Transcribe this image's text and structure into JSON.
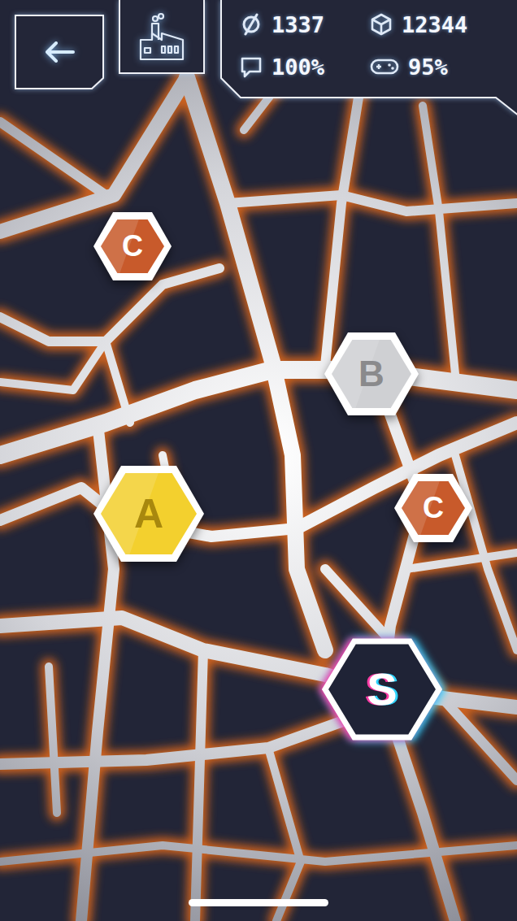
{
  "stats": [
    {
      "kind": "coins",
      "value": "1337"
    },
    {
      "kind": "cubes",
      "value": "12344"
    },
    {
      "kind": "chat",
      "value": "100%"
    },
    {
      "kind": "gamepad",
      "value": "95%"
    }
  ],
  "markers": [
    {
      "label": "C",
      "kind": "small",
      "color": "#c85a2b"
    },
    {
      "label": "B",
      "kind": "medium",
      "color": "#cfd0d3"
    },
    {
      "label": "A",
      "kind": "large",
      "color": "#f3d02e"
    },
    {
      "label": "C",
      "kind": "small",
      "color": "#c85a2b"
    },
    {
      "label": "S",
      "kind": "neon",
      "color": "#ff3ca6"
    }
  ]
}
